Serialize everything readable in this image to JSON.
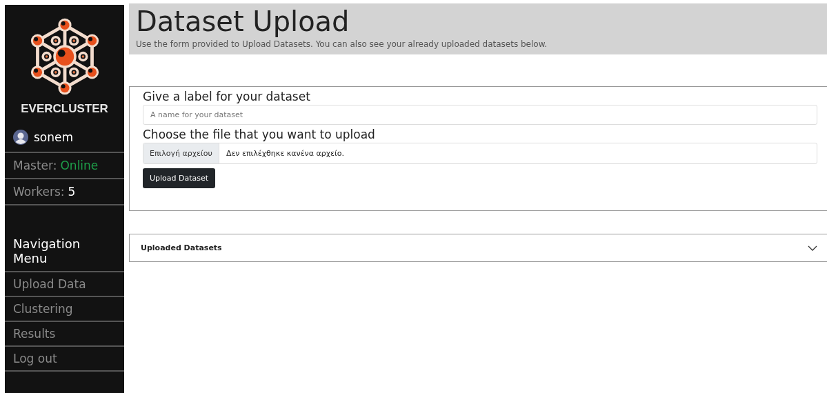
{
  "sidebar": {
    "brand": "EVERCLUSTER",
    "user": "sonem",
    "status": [
      {
        "label": "Master:",
        "value": "Online",
        "kind": "state"
      },
      {
        "label": "Workers:",
        "value": "5",
        "kind": "count"
      }
    ],
    "nav_title": "Navigation Menu",
    "nav_items": [
      "Upload Data",
      "Clustering",
      "Results",
      "Log out"
    ]
  },
  "header": {
    "title": "Dataset Upload",
    "subtitle": "Use the form provided to Upload Datasets. You can also see your already uploaded datasets below."
  },
  "form": {
    "label_heading": "Give a label for your dataset",
    "label_placeholder": "A name for your dataset",
    "file_heading": "Choose the file that you want to upload",
    "file_button": "Επιλογή αρχείου",
    "file_status": "Δεν επιλέχθηκε κανένα αρχείο.",
    "submit": "Upload Dataset"
  },
  "accordion": {
    "title": "Uploaded Datasets",
    "expanded": false
  }
}
